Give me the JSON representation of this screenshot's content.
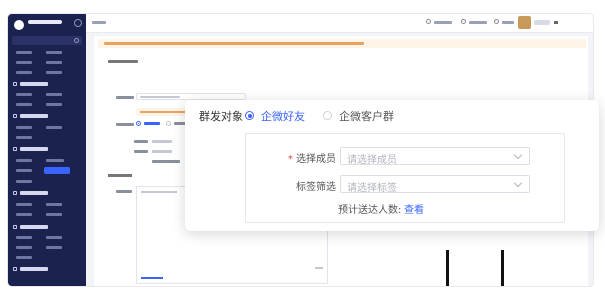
{
  "overlay": {
    "send_target_label": "群发对象",
    "options": [
      {
        "label": "企微好友",
        "selected": true
      },
      {
        "label": "企微客户群",
        "selected": false
      }
    ],
    "member_field": {
      "required_mark": "*",
      "label": "选择成员",
      "placeholder": "请选择成员"
    },
    "tag_field": {
      "label": "标签筛选",
      "placeholder": "请选择标签"
    },
    "estimate": {
      "label": "预计送达人数:",
      "link": "查看"
    }
  },
  "colors": {
    "sidebar_bg": "#1b2250",
    "accent": "#3a64ff",
    "warning_bg": "#fff4e8",
    "required": "#e0443e"
  },
  "icons": [
    "chevron-down-icon",
    "radio-selected-icon",
    "radio-unselected-icon"
  ]
}
